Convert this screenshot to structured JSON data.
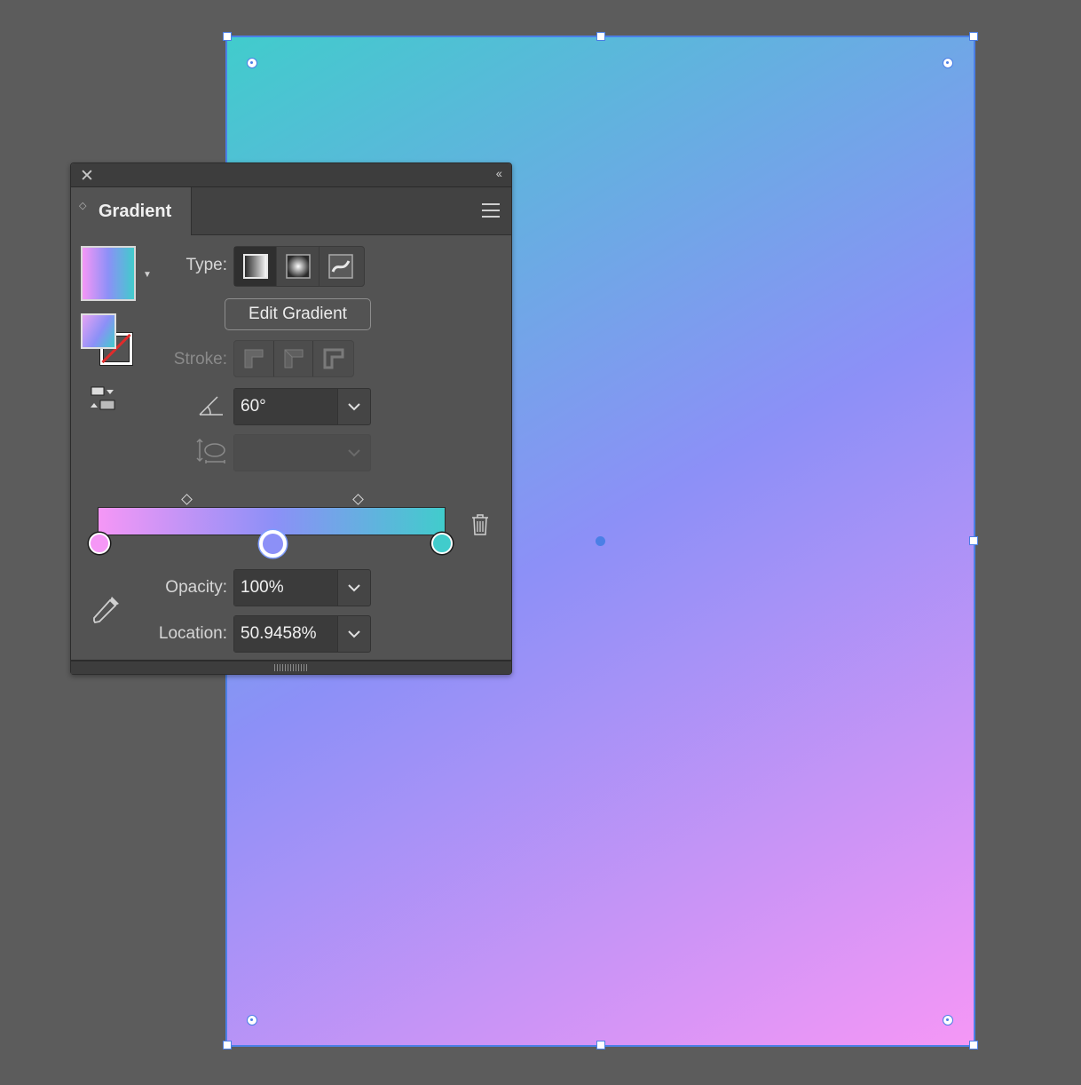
{
  "colors": {
    "canvas_background": "#5c5c5c",
    "selection": "#4b7fe6",
    "stop_start": "#f597f6",
    "stop_middle": "#8c90f7",
    "stop_end": "#41cccc"
  },
  "panel": {
    "close_icon": "close-icon",
    "collapse_icon": "double-chevron-left-icon",
    "tab_label": "Gradient",
    "menu_icon": "hamburger-menu-icon",
    "type_label": "Type:",
    "type_options": [
      "linear-gradient-icon",
      "radial-gradient-icon",
      "freeform-gradient-icon"
    ],
    "type_selected": "linear",
    "edit_button_label": "Edit Gradient",
    "stroke_label": "Stroke:",
    "angle": {
      "icon": "angle-icon",
      "value": "60°"
    },
    "aspect_ratio": {
      "icon": "aspect-ratio-icon",
      "value": ""
    },
    "slider": {
      "stops": [
        {
          "color": "#f597f6",
          "location": 0
        },
        {
          "color": "#8c90f7",
          "location": 50.9458,
          "selected": true
        },
        {
          "color": "#41cccc",
          "location": 100
        }
      ],
      "midpoints": [
        25,
        75
      ]
    },
    "opacity": {
      "label": "Opacity:",
      "value": "100%"
    },
    "location": {
      "label": "Location:",
      "value": "50.9458%"
    }
  }
}
